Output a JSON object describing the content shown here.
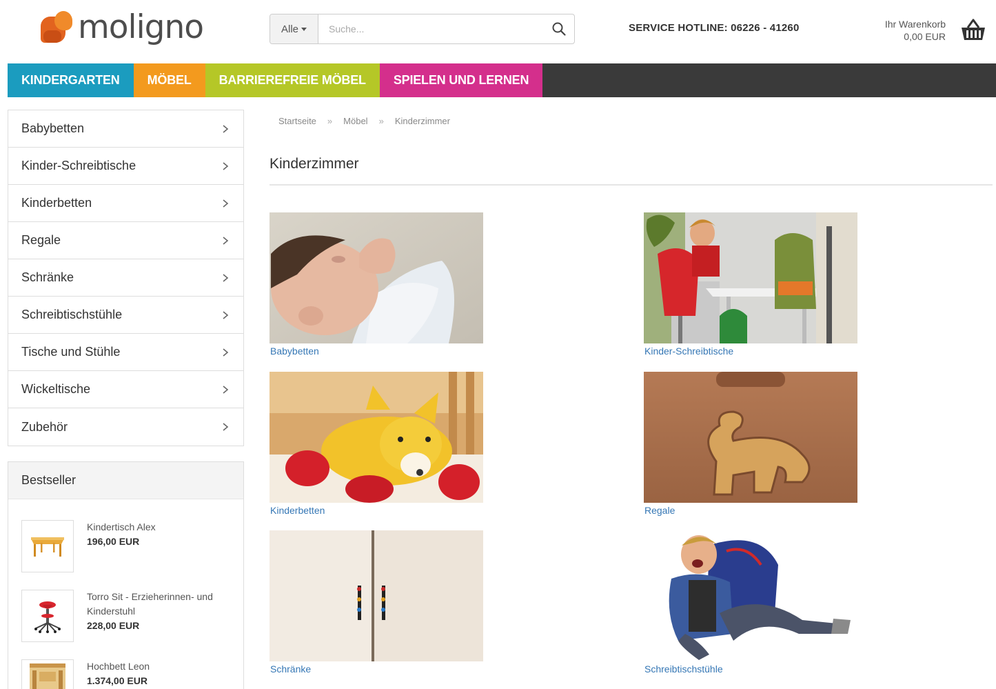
{
  "header": {
    "logo_text": "moligno",
    "search": {
      "category": "Alle",
      "placeholder": "Suche..."
    },
    "hotline": "SERVICE HOTLINE: 06226 - 41260",
    "cart": {
      "label": "Ihr Warenkorb",
      "total": "0,00 EUR"
    }
  },
  "nav": {
    "items": [
      {
        "label": "KINDERGARTEN",
        "color": "#1b9cbf"
      },
      {
        "label": "MÖBEL",
        "color": "#f39a1e"
      },
      {
        "label": "BARRIEREFREIE MÖBEL",
        "color": "#b5c727"
      },
      {
        "label": "SPIELEN UND LERNEN",
        "color": "#d42f8c"
      }
    ],
    "bar_color": "#3a3a3a"
  },
  "sidebar": {
    "categories": [
      "Babybetten",
      "Kinder-Schreibtische",
      "Kinderbetten",
      "Regale",
      "Schränke",
      "Schreibtischstühle",
      "Tische und Stühle",
      "Wickeltische",
      "Zubehör"
    ],
    "bestseller": {
      "title": "Bestseller",
      "items": [
        {
          "name": "Kindertisch Alex",
          "price": "196,00 EUR"
        },
        {
          "name": "Torro Sit - Erzieherinnen- und Kinderstuhl",
          "price": "228,00 EUR"
        },
        {
          "name": "Hochbett Leon",
          "price": "1.374,00 EUR"
        }
      ]
    }
  },
  "breadcrumb": [
    "Startseite",
    "Möbel",
    "Kinderzimmer"
  ],
  "breadcrumb_sep": "»",
  "page_title": "Kinderzimmer",
  "tiles": [
    "Babybetten",
    "Kinder-Schreibtische",
    "Kinderbetten",
    "Regale",
    "Schränke",
    "Schreibtischstühle"
  ]
}
